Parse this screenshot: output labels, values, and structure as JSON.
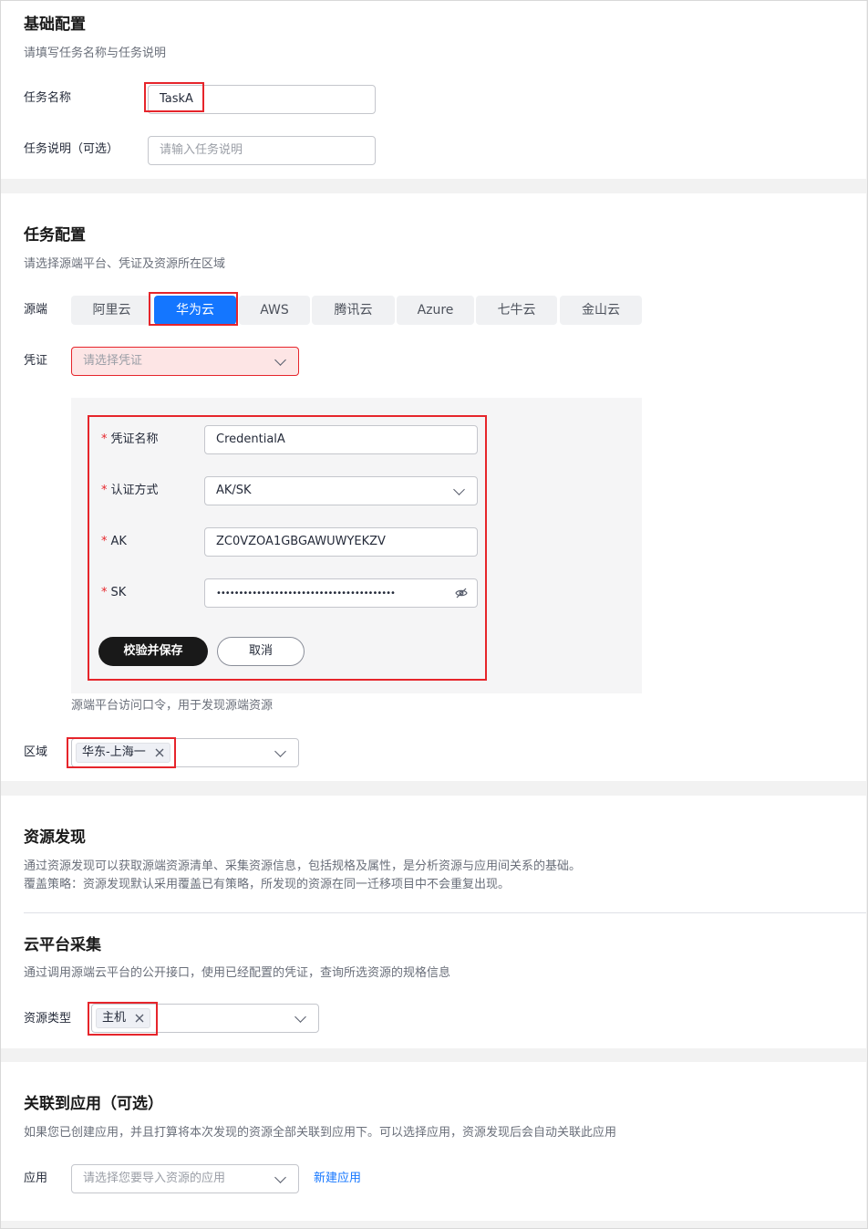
{
  "basic": {
    "title": "基础配置",
    "desc": "请填写任务名称与任务说明",
    "name_label": "任务名称",
    "name_value": "TaskA",
    "desc_label": "任务说明（可选）",
    "desc_placeholder": "请输入任务说明"
  },
  "task": {
    "title": "任务配置",
    "desc": "请选择源端平台、凭证及资源所在区域",
    "source_label": "源端",
    "tabs": [
      "阿里云",
      "华为云",
      "AWS",
      "腾讯云",
      "Azure",
      "七牛云",
      "金山云"
    ],
    "active_tab": "华为云",
    "credential_label": "凭证",
    "credential_placeholder": "请选择凭证",
    "form": {
      "name_label": "凭证名称",
      "name_value": "CredentialA",
      "auth_label": "认证方式",
      "auth_value": "AK/SK",
      "ak_label": "AK",
      "ak_value": "ZC0VZOA1GBGAWUWYEKZV",
      "sk_label": "SK",
      "sk_value": "••••••••••••••••••••••••••••••••••••••••",
      "required_mark": "*",
      "save_button": "校验并保存",
      "cancel_button": "取消"
    },
    "credential_hint": "源端平台访问口令，用于发现源端资源",
    "region_label": "区域",
    "region_tag": "华东-上海一"
  },
  "discovery": {
    "title": "资源发现",
    "desc_line1": "通过资源发现可以获取源端资源清单、采集资源信息，包括规格及属性，是分析资源与应用间关系的基础。",
    "desc_line2": "覆盖策略：资源发现默认采用覆盖已有策略，所发现的资源在同一迁移项目中不会重复出现。",
    "cloud_title": "云平台采集",
    "cloud_desc": "通过调用源端云平台的公开接口，使用已经配置的凭证，查询所选资源的规格信息",
    "resource_type_label": "资源类型",
    "resource_type_tag": "主机"
  },
  "app": {
    "title": "关联到应用（可选）",
    "desc": "如果您已创建应用，并且打算将本次发现的资源全部关联到应用下。可以选择应用，资源发现后会自动关联此应用",
    "label": "应用",
    "placeholder": "请选择您要导入资源的应用",
    "new_link": "新建应用"
  },
  "colors": {
    "accent": "#1476ff",
    "highlight": "#e6252b",
    "error_bg": "#fde5e5"
  }
}
